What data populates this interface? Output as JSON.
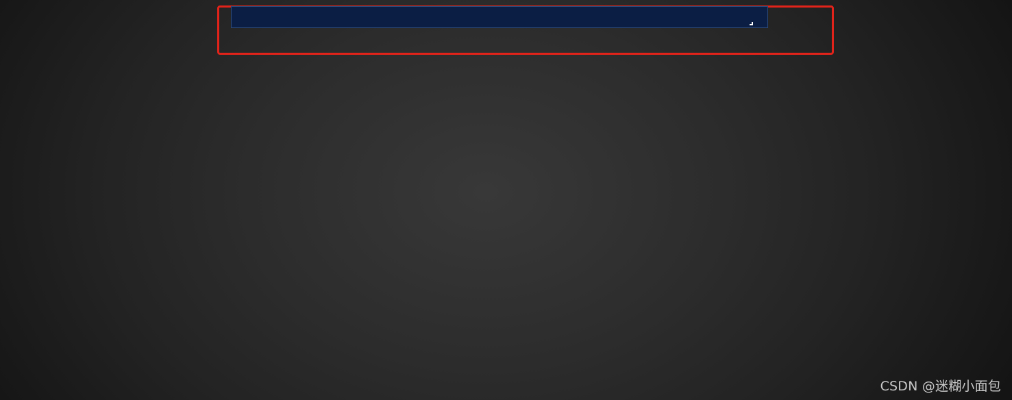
{
  "input_panel": {
    "value": "",
    "placeholder": ""
  },
  "watermark": {
    "text": "CSDN @迷糊小面包"
  },
  "colors": {
    "highlight_border": "#e2231a",
    "panel_background": "#0b1e44",
    "panel_border": "#2d4a7a",
    "page_background_center": "#383838",
    "page_background_edge": "#111111"
  },
  "icons": {
    "resize_handle": "resize-grip-icon"
  }
}
